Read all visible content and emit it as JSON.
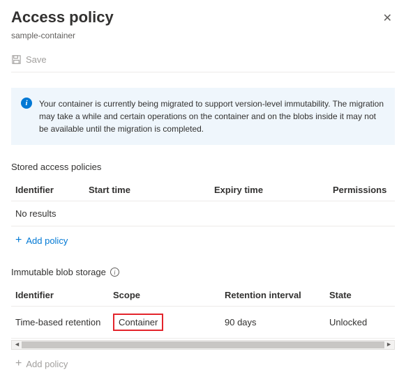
{
  "header": {
    "title": "Access policy",
    "subtitle": "sample-container"
  },
  "toolbar": {
    "save_label": "Save"
  },
  "info": {
    "message": "Your container is currently being migrated to support version-level immutability. The migration may take a while and certain operations on the container and on the blobs inside it may not be available until the migration is completed."
  },
  "stored_policies": {
    "title": "Stored access policies",
    "columns": {
      "identifier": "Identifier",
      "start": "Start time",
      "expiry": "Expiry time",
      "perms": "Permissions"
    },
    "empty": "No results",
    "add_label": "Add policy"
  },
  "immutable": {
    "title": "Immutable blob storage",
    "columns": {
      "identifier": "Identifier",
      "scope": "Scope",
      "retention": "Retention interval",
      "state": "State"
    },
    "rows": [
      {
        "identifier": "Time-based retention",
        "scope": "Container",
        "retention": "90 days",
        "state": "Unlocked"
      }
    ],
    "add_label": "Add policy"
  }
}
